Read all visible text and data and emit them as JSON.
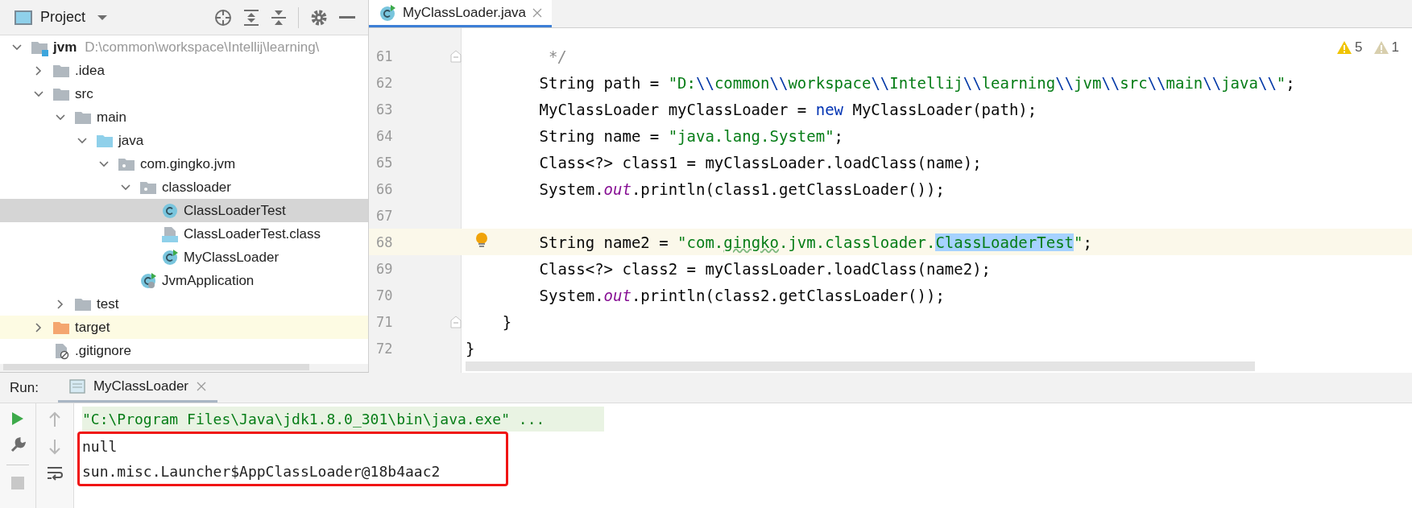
{
  "project_panel": {
    "title": "Project",
    "tree": [
      {
        "label": "jvm",
        "path": "D:\\common\\workspace\\Intellij\\learning\\",
        "kind": "module",
        "expanded": true,
        "selected": false,
        "children": [
          {
            "label": ".idea",
            "kind": "folder",
            "expanded": false,
            "selected": false
          },
          {
            "label": "src",
            "kind": "folder",
            "expanded": true,
            "selected": false,
            "children": [
              {
                "label": "main",
                "kind": "folder",
                "expanded": true,
                "selected": false,
                "children": [
                  {
                    "label": "java",
                    "kind": "source-folder",
                    "expanded": true,
                    "selected": false,
                    "children": [
                      {
                        "label": "com.gingko.jvm",
                        "kind": "package",
                        "expanded": true,
                        "selected": false,
                        "children": [
                          {
                            "label": "classloader",
                            "kind": "package",
                            "expanded": true,
                            "selected": false,
                            "children": [
                              {
                                "label": "ClassLoaderTest",
                                "kind": "class",
                                "selected": true
                              },
                              {
                                "label": "ClassLoaderTest.class",
                                "kind": "class-file",
                                "selected": false
                              },
                              {
                                "label": "MyClassLoader",
                                "kind": "runnable-class",
                                "selected": false
                              }
                            ]
                          },
                          {
                            "label": "JvmApplication",
                            "kind": "app-class",
                            "selected": false
                          }
                        ]
                      }
                    ]
                  }
                ]
              },
              {
                "label": "test",
                "kind": "folder",
                "expanded": false,
                "selected": false
              }
            ]
          },
          {
            "label": "target",
            "kind": "excluded-folder",
            "expanded": false,
            "selected": false
          },
          {
            "label": ".gitignore",
            "kind": "ignore-file",
            "selected": false
          }
        ]
      }
    ]
  },
  "editor": {
    "tab": {
      "label": "MyClassLoader.java",
      "selected": true
    },
    "inspections": [
      {
        "kind": "warning",
        "count": "5"
      },
      {
        "kind": "weak-warning",
        "count": "1"
      }
    ],
    "lines": [
      {
        "number": "61",
        "fold": true,
        "current": false,
        "bulb": false,
        "tokens": [
          {
            "kind": "comment",
            "text": "         */"
          }
        ]
      },
      {
        "number": "62",
        "fold": false,
        "current": false,
        "bulb": false,
        "tokens": [
          {
            "kind": "plain",
            "text": "        String path = "
          },
          {
            "kind": "string",
            "text": "\"D:"
          },
          {
            "kind": "escape",
            "text": "\\\\"
          },
          {
            "kind": "string",
            "text": "common"
          },
          {
            "kind": "escape",
            "text": "\\\\"
          },
          {
            "kind": "string",
            "text": "workspace"
          },
          {
            "kind": "escape",
            "text": "\\\\"
          },
          {
            "kind": "string",
            "text": "Intellij"
          },
          {
            "kind": "escape",
            "text": "\\\\"
          },
          {
            "kind": "string",
            "text": "learning"
          },
          {
            "kind": "escape",
            "text": "\\\\"
          },
          {
            "kind": "string",
            "text": "jvm"
          },
          {
            "kind": "escape",
            "text": "\\\\"
          },
          {
            "kind": "string",
            "text": "src"
          },
          {
            "kind": "escape",
            "text": "\\\\"
          },
          {
            "kind": "string",
            "text": "main"
          },
          {
            "kind": "escape",
            "text": "\\\\"
          },
          {
            "kind": "string",
            "text": "java"
          },
          {
            "kind": "escape",
            "text": "\\\\"
          },
          {
            "kind": "string",
            "text": "\""
          },
          {
            "kind": "plain",
            "text": ";"
          }
        ]
      },
      {
        "number": "63",
        "fold": false,
        "current": false,
        "bulb": false,
        "tokens": [
          {
            "kind": "plain",
            "text": "        MyClassLoader myClassLoader = "
          },
          {
            "kind": "keyword",
            "text": "new"
          },
          {
            "kind": "plain",
            "text": " MyClassLoader(path);"
          }
        ]
      },
      {
        "number": "64",
        "fold": false,
        "current": false,
        "bulb": false,
        "tokens": [
          {
            "kind": "plain",
            "text": "        String name = "
          },
          {
            "kind": "string",
            "text": "\"java.lang.System\""
          },
          {
            "kind": "plain",
            "text": ";"
          }
        ]
      },
      {
        "number": "65",
        "fold": false,
        "current": false,
        "bulb": false,
        "tokens": [
          {
            "kind": "plain",
            "text": "        Class<?> class1 = myClassLoader.loadClass(name);"
          }
        ]
      },
      {
        "number": "66",
        "fold": false,
        "current": false,
        "bulb": false,
        "tokens": [
          {
            "kind": "plain",
            "text": "        System."
          },
          {
            "kind": "field",
            "text": "out"
          },
          {
            "kind": "plain",
            "text": ".println(class1.getClassLoader());"
          }
        ]
      },
      {
        "number": "67",
        "fold": false,
        "current": false,
        "bulb": false
      },
      {
        "number": "68",
        "fold": false,
        "current": true,
        "bulb": true,
        "tokens": [
          {
            "kind": "plain",
            "text": "        String name2 = "
          },
          {
            "kind": "string",
            "text": "\"com."
          },
          {
            "kind": "typo",
            "text": "gingko"
          },
          {
            "kind": "string",
            "text": ".jvm.classloader."
          },
          {
            "kind": "selection",
            "text": "ClassLoaderTest"
          },
          {
            "kind": "string",
            "text": "\""
          },
          {
            "kind": "plain",
            "text": ";"
          }
        ]
      },
      {
        "number": "69",
        "fold": false,
        "current": false,
        "bulb": false,
        "tokens": [
          {
            "kind": "plain",
            "text": "        Class<?> class2 = myClassLoader.loadClass(name2);"
          }
        ]
      },
      {
        "number": "70",
        "fold": false,
        "current": false,
        "bulb": false,
        "tokens": [
          {
            "kind": "plain",
            "text": "        System."
          },
          {
            "kind": "field",
            "text": "out"
          },
          {
            "kind": "plain",
            "text": ".println(class2.getClassLoader());"
          }
        ]
      },
      {
        "number": "71",
        "fold": true,
        "current": false,
        "bulb": false,
        "tokens": [
          {
            "kind": "plain",
            "text": "    }"
          }
        ]
      },
      {
        "number": "72",
        "fold": false,
        "current": false,
        "bulb": false,
        "tokens": [
          {
            "kind": "plain",
            "text": "}"
          }
        ]
      }
    ]
  },
  "run_panel": {
    "label": "Run:",
    "tab": {
      "label": "MyClassLoader",
      "selected": true
    },
    "console": [
      {
        "kind": "command",
        "boxed": false,
        "text": "\"C:\\Program Files\\Java\\jdk1.8.0_301\\bin\\java.exe\" ..."
      },
      {
        "kind": "output",
        "boxed": true,
        "text": "null"
      },
      {
        "kind": "output",
        "boxed": true,
        "text": "sun.misc.Launcher$AppClassLoader@18b4aac2"
      }
    ]
  }
}
